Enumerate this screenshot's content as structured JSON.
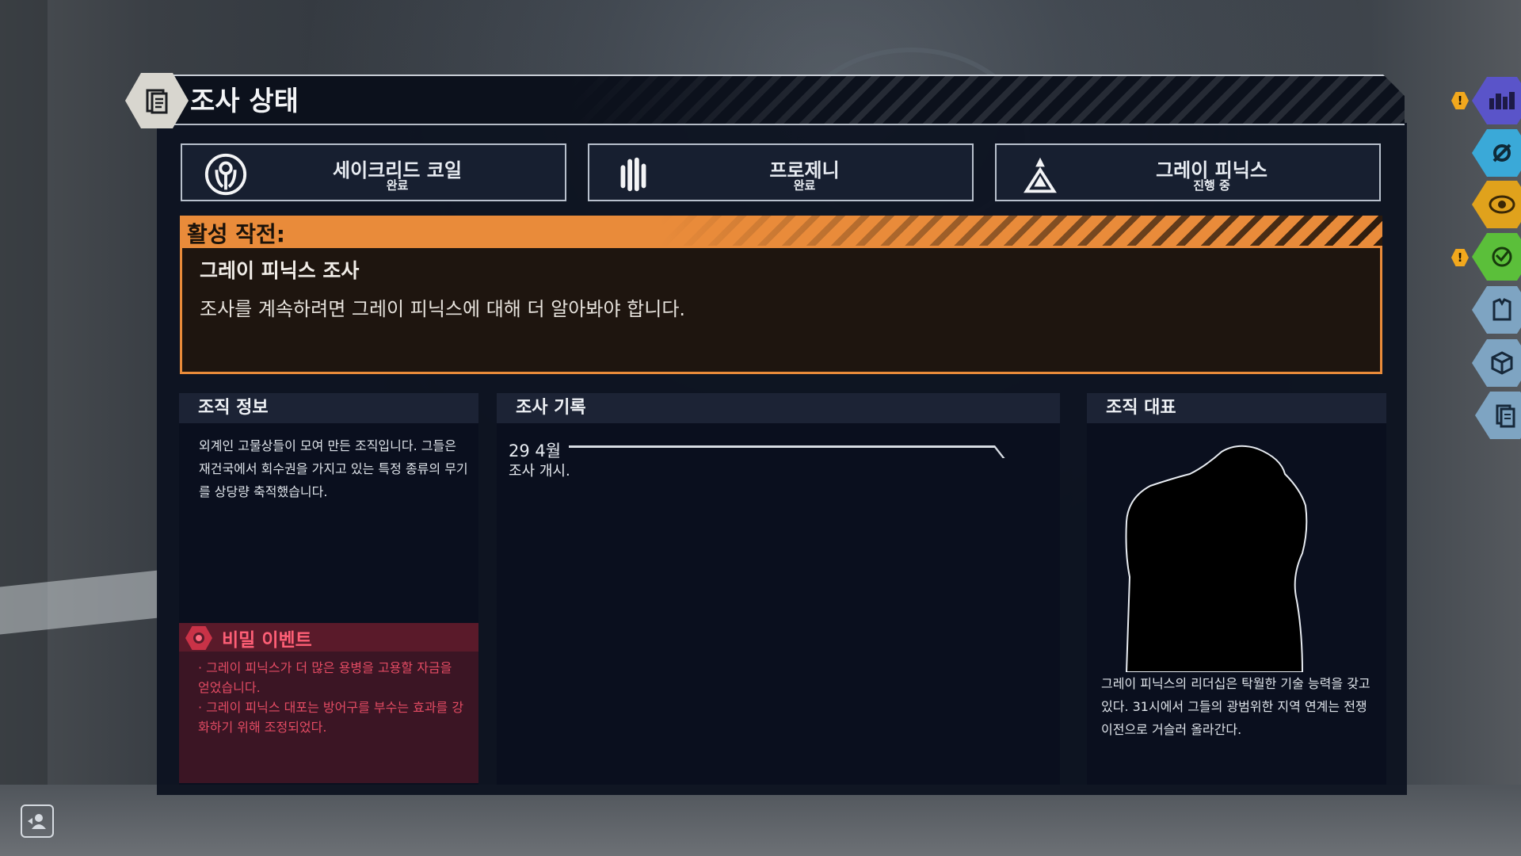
{
  "screen": {
    "title": "조사 상태",
    "title_icon": "document-icon"
  },
  "factions": [
    {
      "name": "세이크리드 코일",
      "status": "완료",
      "icon": "sacred-coil-icon"
    },
    {
      "name": "프로제니",
      "status": "완료",
      "icon": "progeny-icon"
    },
    {
      "name": "그레이 피닉스",
      "status": "진행 중",
      "icon": "grey-phoenix-icon"
    }
  ],
  "active_op": {
    "header": "활성 작전:",
    "title": "그레이 피닉스 조사",
    "description": "조사를 계속하려면 그레이 피닉스에 대해 더 알아봐야 합니다."
  },
  "org_info": {
    "heading": "조직 정보",
    "description": "외계인 고물상들이 모여 만든 조직입니다. 그들은 재건국에서 회수권을 가지고 있는 특정 종류의 무기를 상당량 축적했습니다."
  },
  "secret_events": {
    "heading": "비밀 이벤트",
    "items": [
      "· 그레이 피닉스가 더 많은 용병을 고용할 자금을 얻었습니다.",
      "· 그레이 피닉스 대포는 방어구를 부수는 효과를 강화하기 위해 조정되었다."
    ]
  },
  "investigation_log": {
    "heading": "조사 기록",
    "entries": [
      {
        "date": "29 4월",
        "text": "조사 개시."
      }
    ]
  },
  "leader": {
    "heading": "조직 대표",
    "description": "그레이 피닉스의 리더십은 탁월한 기술 능력을 갖고 있다. 31시에서 그들의 광범위한 지역 연계는 전쟁 이전으로 거슬러 올라간다."
  },
  "side_menu": [
    {
      "icon": "city-icon",
      "color": "#5a54c9",
      "alert": true
    },
    {
      "icon": "sabotage-icon",
      "color": "#3aa9d8",
      "alert": false
    },
    {
      "icon": "eye-icon",
      "color": "#e0a21c",
      "alert": false
    },
    {
      "icon": "network-icon",
      "color": "#5bbf3a",
      "alert": true
    },
    {
      "icon": "armor-icon",
      "color": "#7ea4c2",
      "alert": false
    },
    {
      "icon": "supply-crate-icon",
      "color": "#7ea4c2",
      "alert": false
    },
    {
      "icon": "document-icon",
      "color": "#7ea4c2",
      "alert": false
    }
  ],
  "alert_symbol": "!",
  "colors": {
    "accent_orange": "#e98b3a",
    "secret_red": "#e34b63",
    "panel_bg": "#0c1220"
  }
}
